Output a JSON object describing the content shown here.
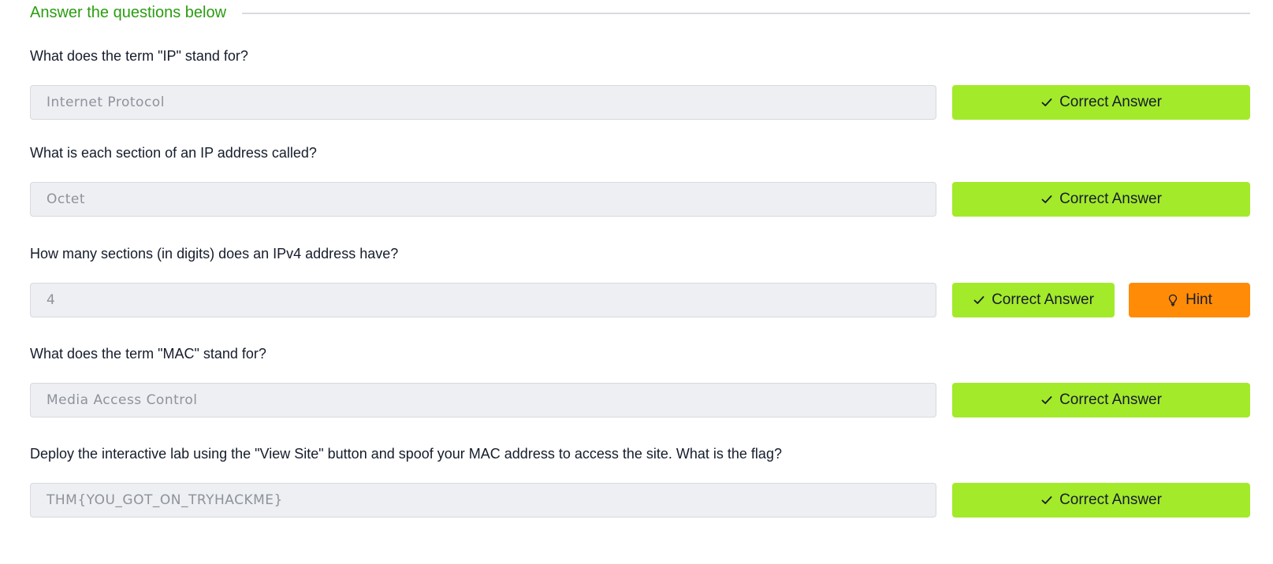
{
  "section": {
    "title": "Answer the questions below"
  },
  "questions": [
    {
      "question": "What does the term \"IP\" stand for?",
      "answer": "Internet Protocol",
      "correct_label": "Correct Answer",
      "check_icon": "check-icon"
    },
    {
      "question": "What is each section of an IP address called?",
      "answer": "Octet",
      "correct_label": "Correct Answer",
      "check_icon": "check-icon"
    },
    {
      "question": "How many sections (in digits) does an IPv4 address have?",
      "answer": "4",
      "correct_label": "Correct Answer",
      "check_icon": "check-icon",
      "hint_label": "Hint",
      "hint_icon": "lightbulb-icon"
    },
    {
      "question": "What does the term \"MAC\" stand for?",
      "answer": "Media Access Control",
      "correct_label": "Correct Answer",
      "check_icon": "check-icon"
    },
    {
      "question": "Deploy the interactive lab using the \"View Site\" button and spoof your MAC address to access the site.  What is the flag?",
      "answer": "THM{YOU_GOT_ON_TRYHACKME}",
      "correct_label": "Correct Answer",
      "check_icon": "check-icon"
    }
  ],
  "colors": {
    "accent_green_text": "#2a9d10",
    "correct_button": "#a3ea2a",
    "hint_button": "#ff8b06",
    "input_background": "#eeeff2",
    "text": "#151c2b"
  }
}
